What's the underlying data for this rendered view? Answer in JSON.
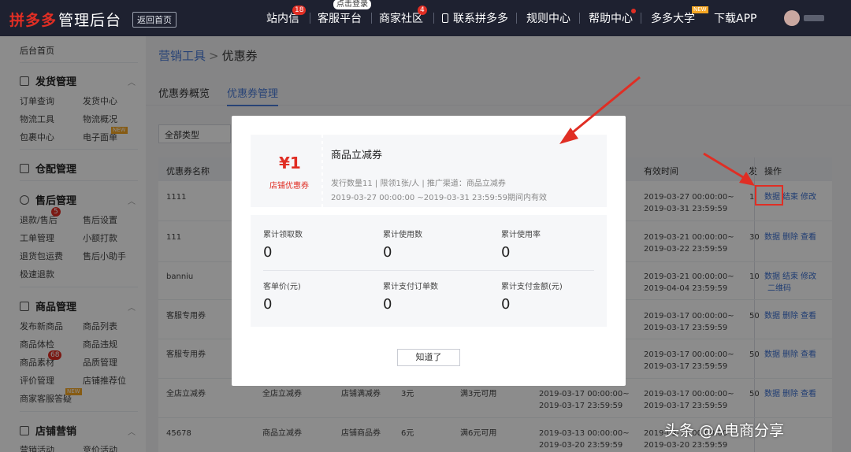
{
  "header": {
    "logo_brand": "拼多多",
    "logo_text": "管理后台",
    "back_home": "返回首页",
    "nav": [
      {
        "label": "站内信",
        "badge": "18"
      },
      {
        "label": "客服平台",
        "tip": "点击登录"
      },
      {
        "label": "商家社区",
        "badge": "4"
      },
      {
        "label": "联系拼多多"
      },
      {
        "label": "规则中心"
      },
      {
        "label": "帮助中心"
      },
      {
        "label": "多多大学",
        "tag": "NEW"
      },
      {
        "label": "下载APP"
      }
    ]
  },
  "sidebar": {
    "home": "后台首页",
    "groups": [
      {
        "title": "发货管理",
        "items": [
          "订单查询",
          "发货中心",
          "物流工具",
          "物流概况",
          "包裹中心",
          "电子面单"
        ],
        "tag": "NEW"
      },
      {
        "title": "仓配管理"
      },
      {
        "title": "售后管理",
        "items": [
          "退款/售后",
          "售后设置",
          "工单管理",
          "小额打款",
          "退货包运费",
          "售后小助手",
          "极速退款"
        ],
        "badge": "5"
      },
      {
        "title": "商品管理",
        "items": [
          "发布新商品",
          "商品列表",
          "商品体检",
          "商品违规",
          "商品素材",
          "品质管理",
          "评价管理",
          "店铺推荐位",
          "商家客服答疑"
        ],
        "badge": "68",
        "tag": "NEW"
      },
      {
        "title": "店铺营销",
        "items": [
          "营销活动",
          "竞价活动"
        ]
      }
    ]
  },
  "breadcrumb": {
    "parent": "营销工具",
    "separator": ">",
    "current": "优惠券"
  },
  "tabs": [
    {
      "label": "优惠券概览"
    },
    {
      "label": "优惠券管理"
    }
  ],
  "filter": {
    "type_select": "全部类型"
  },
  "table": {
    "headers": [
      "优惠券名称",
      "有效时间",
      "发",
      "操作"
    ],
    "rows": [
      {
        "name": "1111",
        "time1": "2019-03-27 00:00:00~",
        "time2": "2019-03-31 23:59:59",
        "issued": "1",
        "ops": [
          "数据",
          "结束",
          "修改"
        ]
      },
      {
        "name": "111",
        "time1": "2019-03-21 00:00:00~",
        "time2": "2019-03-22 23:59:59",
        "issued": "30",
        "ops": [
          "数据",
          "删除",
          "查看"
        ]
      },
      {
        "name": "banniu",
        "time1": "2019-03-21 00:00:00~",
        "time2": "2019-04-04 23:59:59",
        "issued": "10",
        "ops": [
          "数据",
          "结束",
          "修改"
        ],
        "ops2": "二维码"
      },
      {
        "name": "客服专用券",
        "time1": "2019-03-17 00:00:00~",
        "time2": "2019-03-17 23:59:59",
        "issued": "50",
        "ops": [
          "数据",
          "删除",
          "查看"
        ]
      },
      {
        "name": "客服专用券",
        "time1": "2019-03-17 00:00:00~",
        "time2": "2019-03-17 23:59:59",
        "issued": "50",
        "ops": [
          "数据",
          "删除",
          "查看"
        ]
      },
      {
        "name": "全店立减券",
        "type": "全店立减券",
        "scope": "店铺满减券",
        "value": "3元",
        "rule": "满3元可用",
        "time1": "2019-03-17 00:00:00~",
        "time2": "2019-03-17 23:59:59",
        "issued": "50",
        "ops": [
          "数据",
          "删除",
          "查看"
        ]
      },
      {
        "name": "45678",
        "type": "商品立减券",
        "scope": "店铺商品券",
        "value": "6元",
        "rule": "满6元可用",
        "time1": "2019-03-13 00:00:00~",
        "time2": "2019-03-20 23:59:59",
        "issued": "",
        "ops": []
      }
    ]
  },
  "modal": {
    "amount": "¥1",
    "store_tag": "店铺优惠券",
    "title": "商品立减券",
    "meta": "发行数量11 | 限领1张/人 | 推广渠道：商品立减券",
    "time": "2019-03-27 00:00:00 ~2019-03-31 23:59:59期间内有效",
    "stats": [
      {
        "label": "累计领取数",
        "value": "0"
      },
      {
        "label": "累计使用数",
        "value": "0"
      },
      {
        "label": "累计使用率",
        "value": "0"
      },
      {
        "label": "客单价(元)",
        "value": "0"
      },
      {
        "label": "累计支付订单数",
        "value": "0"
      },
      {
        "label": "累计支付金额(元)",
        "value": "0"
      }
    ],
    "ok_button": "知道了"
  },
  "watermark": "头条 @A电商分享",
  "colors": {
    "accent": "#e02e24",
    "link": "#3a6fd1",
    "tab_active": "#4a7bd8",
    "topbar": "#1e2130"
  }
}
